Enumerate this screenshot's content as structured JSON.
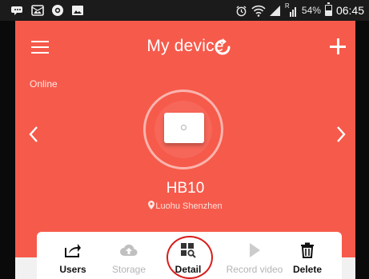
{
  "status_bar": {
    "left_icons": [
      "message-icon",
      "picture-mail-icon",
      "browser-icon",
      "gallery-icon"
    ],
    "right_icons": [
      "alarm-icon",
      "wifi-icon",
      "signal-icon",
      "roaming-signal-icon",
      "battery-icon"
    ],
    "roaming_mark": "R",
    "battery_percent": "54%",
    "battery_level": 0.54,
    "time": "06:45"
  },
  "header": {
    "menu_icon": "menu-icon",
    "title": "My device",
    "refresh_icon": "refresh-icon",
    "add_icon": "plus-icon"
  },
  "device": {
    "status": "Online",
    "name": "HB10",
    "location": "Luohu Shenzhen",
    "location_icon": "location-pin-icon",
    "prev_icon": "chevron-left-icon",
    "next_icon": "chevron-right-icon"
  },
  "actions": [
    {
      "id": "users",
      "label": "Users",
      "icon": "share-icon",
      "enabled": true
    },
    {
      "id": "storage",
      "label": "Storage",
      "icon": "cloud-upload-icon",
      "enabled": false
    },
    {
      "id": "detail",
      "label": "Detail",
      "icon": "detail-grid-icon",
      "enabled": true,
      "highlighted": true
    },
    {
      "id": "record",
      "label": "Record video",
      "icon": "play-icon",
      "enabled": false
    },
    {
      "id": "delete",
      "label": "Delete",
      "icon": "trash-icon",
      "enabled": true
    }
  ],
  "colors": {
    "panel": "#f65a4b",
    "status_bar": "#1b1b1b",
    "highlight": "#d81d1d"
  }
}
